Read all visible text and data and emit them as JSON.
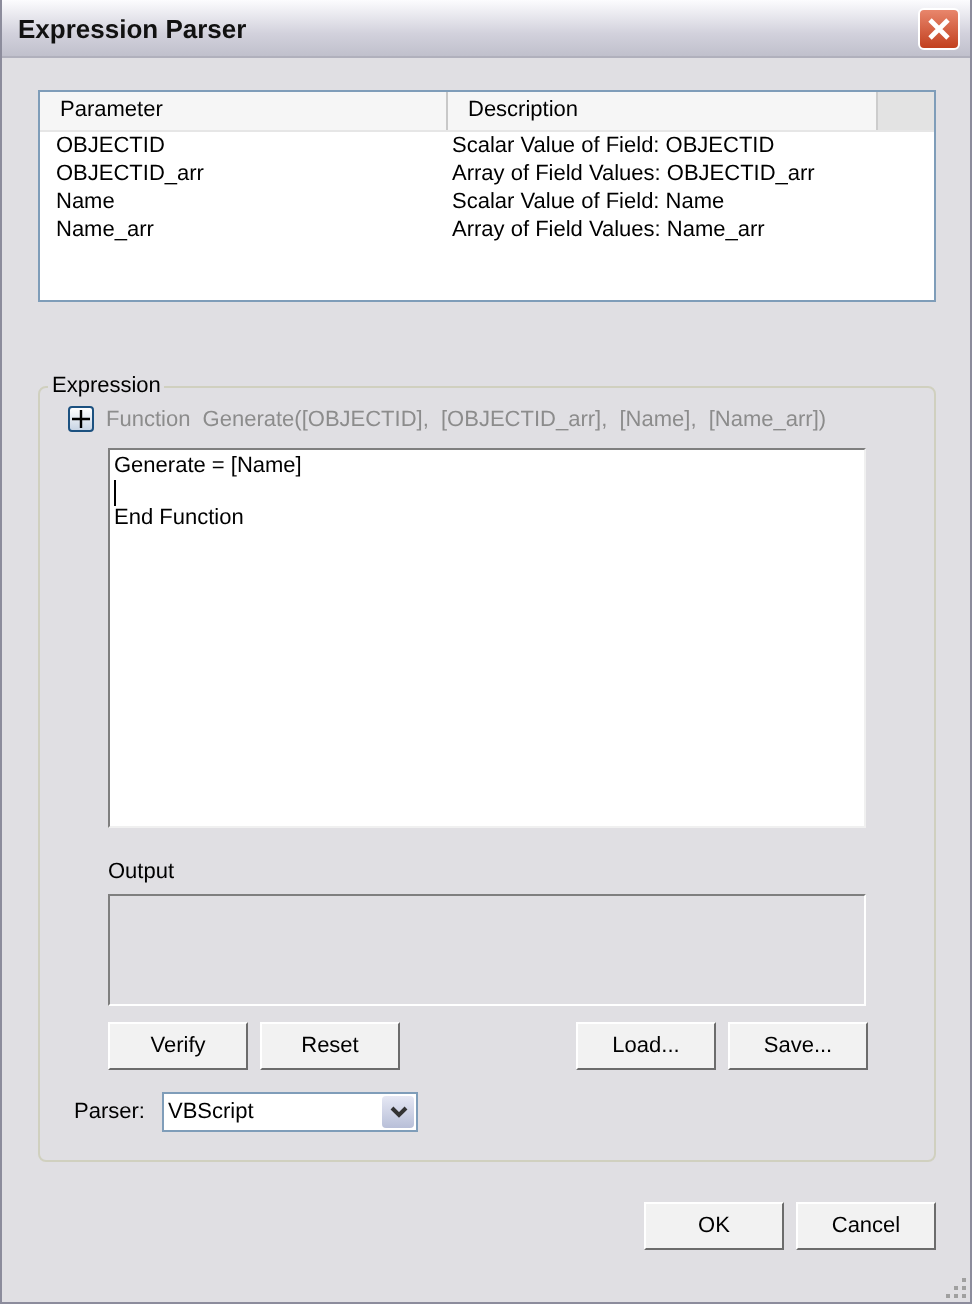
{
  "window": {
    "title": "Expression Parser"
  },
  "table": {
    "columns": [
      "Parameter",
      "Description"
    ],
    "rows": [
      {
        "cells": [
          "OBJECTID",
          "Scalar Value of Field: OBJECTID"
        ]
      },
      {
        "cells": [
          "OBJECTID_arr",
          "Array of Field Values: OBJECTID_arr"
        ]
      },
      {
        "cells": [
          "Name",
          "Scalar Value of Field: Name"
        ]
      },
      {
        "cells": [
          "Name_arr",
          "Array of Field Values: Name_arr"
        ]
      }
    ]
  },
  "expression": {
    "label": "Expression",
    "function_header": {
      "expanded": false,
      "disabled": true,
      "text": "Function  Generate([OBJECTID],  [OBJECTID_arr],  [Name],  [Name_arr])"
    },
    "code_lines": [
      {
        "text": "Generate = [Name]",
        "cursor": false
      },
      {
        "cursor": true
      },
      {
        "text": "End Function",
        "cursor": false
      }
    ],
    "output_label": "Output",
    "left_buttons": [
      "Verify",
      "Reset"
    ],
    "right_buttons": [
      "Load...",
      "Save..."
    ],
    "parser": {
      "label": "Parser:",
      "value": "VBScript"
    }
  },
  "buttons": [
    "OK",
    "Cancel"
  ]
}
